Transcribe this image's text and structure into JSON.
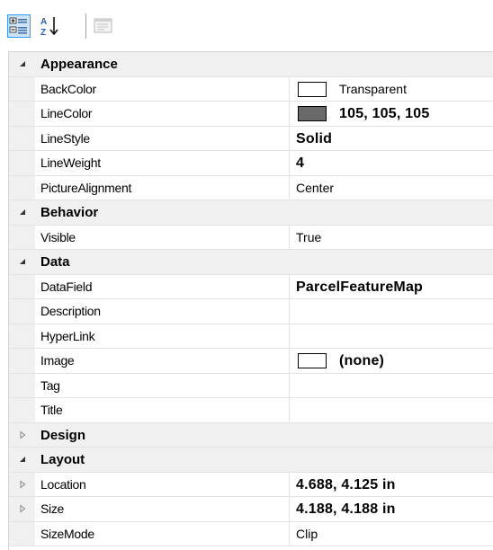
{
  "toolbar": {
    "categorized_icon": "categorized-icon",
    "alphabetical_icon": "alphabetical-sort-icon",
    "property_pages_icon": "property-pages-icon"
  },
  "categories": {
    "appearance": "Appearance",
    "behavior": "Behavior",
    "data": "Data",
    "design": "Design",
    "layout": "Layout"
  },
  "props": {
    "backcolor": {
      "name": "BackColor",
      "value": "Transparent",
      "swatch": "#ffffff"
    },
    "linecolor": {
      "name": "LineColor",
      "value": "105, 105, 105",
      "swatch": "#696969"
    },
    "linestyle": {
      "name": "LineStyle",
      "value": "Solid"
    },
    "lineweight": {
      "name": "LineWeight",
      "value": "4"
    },
    "picturealignment": {
      "name": "PictureAlignment",
      "value": "Center"
    },
    "visible": {
      "name": "Visible",
      "value": "True"
    },
    "datafield": {
      "name": "DataField",
      "value": "ParcelFeatureMap"
    },
    "description": {
      "name": "Description",
      "value": ""
    },
    "hyperlink": {
      "name": "HyperLink",
      "value": ""
    },
    "image": {
      "name": "Image",
      "value": "(none)",
      "swatch": "#ffffff"
    },
    "tag": {
      "name": "Tag",
      "value": ""
    },
    "title": {
      "name": "Title",
      "value": ""
    },
    "location": {
      "name": "Location",
      "value": "4.688, 4.125 in"
    },
    "size": {
      "name": "Size",
      "value": "4.188, 4.188 in"
    },
    "sizemode": {
      "name": "SizeMode",
      "value": "Clip"
    }
  },
  "colors": {
    "selected_button_border": "#3399ff",
    "selected_button_fill": "#cce4f7",
    "category_background": "#f0f0f0",
    "grid_line": "#e3e3e3"
  }
}
